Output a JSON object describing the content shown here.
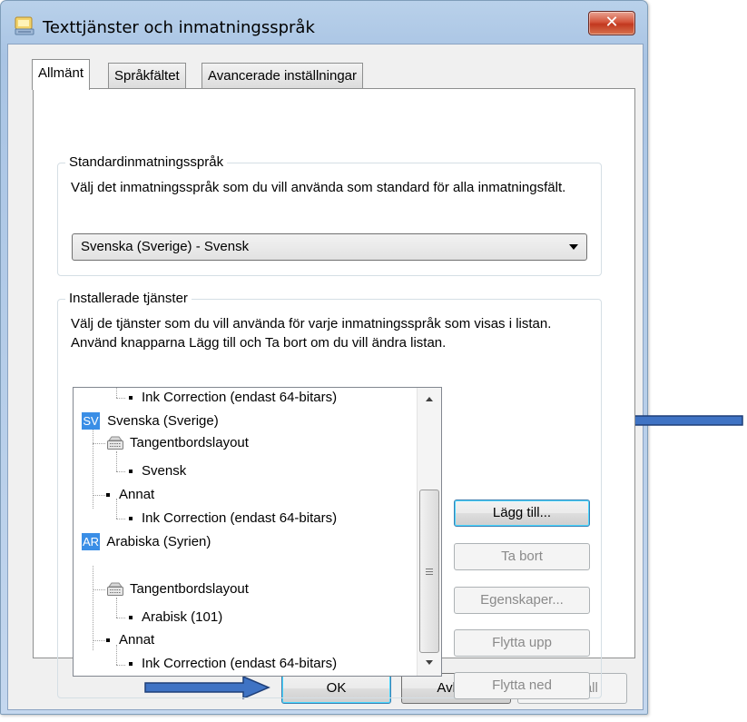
{
  "window": {
    "title": "Texttjänster och inmatningsspråk",
    "close_glyph": "✕"
  },
  "tabs": [
    {
      "label": "Allmänt",
      "active": true
    },
    {
      "label": "Språkfältet",
      "active": false
    },
    {
      "label": "Avancerade inställningar",
      "active": false
    }
  ],
  "default_language": {
    "group_title": "Standardinmatningsspråk",
    "description": "Välj det inmatningsspråk som du vill använda som standard för alla inmatningsfält.",
    "selected": "Svenska (Sverige) - Svensk"
  },
  "installed_services": {
    "group_title": "Installerade tjänster",
    "description": "Välj de tjänster som du vill använda för varje inmatningsspråk som visas i listan. Använd knapparna Lägg till och Ta bort om du vill ändra listan.",
    "tree": [
      {
        "text": "Ink Correction (endast 64-bitars)",
        "type": "bullet"
      },
      {
        "text": "Svenska (Sverige)",
        "type": "language",
        "badge": "SV"
      },
      {
        "text": "Tangentbordslayout",
        "type": "keyboard"
      },
      {
        "text": "Svensk",
        "type": "bullet"
      },
      {
        "text": "Annat",
        "type": "bullet"
      },
      {
        "text": "Ink Correction (endast 64-bitars)",
        "type": "bullet"
      },
      {
        "text": "Arabiska (Syrien)",
        "type": "language",
        "badge": "AR"
      },
      {
        "text": "Tangentbordslayout",
        "type": "keyboard"
      },
      {
        "text": "Arabisk (101)",
        "type": "bullet"
      },
      {
        "text": "Annat",
        "type": "bullet"
      },
      {
        "text": "Ink Correction (endast 64-bitars)",
        "type": "bullet"
      }
    ],
    "buttons": {
      "add": "Lägg till...",
      "remove": "Ta bort",
      "properties": "Egenskaper...",
      "move_up": "Flytta upp",
      "move_down": "Flytta ned"
    }
  },
  "footer": {
    "ok": "OK",
    "cancel": "Avbryt",
    "apply": "Verkställ"
  },
  "colors": {
    "language_badge": "#3a8ee6",
    "annotation_arrow": "#2f5da8",
    "close_button": "#c2381f"
  },
  "icons": {
    "title": "keyboard-settings-icon",
    "keyboard_layout": "keyboard-icon"
  }
}
